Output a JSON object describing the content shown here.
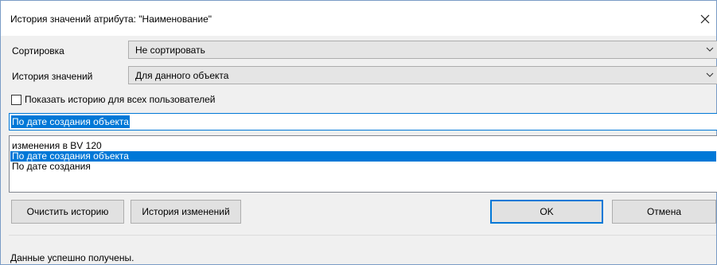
{
  "window": {
    "title": "История значений атрибута: \"Наименование\""
  },
  "sort": {
    "label": "Сортировка",
    "value": "Не сортировать"
  },
  "history": {
    "label": "История значений",
    "value": "Для данного объекта"
  },
  "show_all_users": {
    "label": "Показать историю для всех пользователей",
    "checked": false
  },
  "text_field": {
    "value": "По дате создания объекта"
  },
  "list": {
    "items": [
      {
        "label": "изменения в BV 120",
        "selected": false
      },
      {
        "label": "По дате создания объекта",
        "selected": true
      },
      {
        "label": "По дате создания",
        "selected": false
      }
    ]
  },
  "buttons": {
    "clear_history": "Очистить историю",
    "change_history": "История изменений",
    "ok": "OK",
    "cancel": "Отмена"
  },
  "status": {
    "text": "Данные успешно получены."
  },
  "colors": {
    "accent": "#0078d7",
    "window_bg": "#f0f0f0",
    "combo_bg": "#e5e5e5",
    "button_bg": "#e1e1e1"
  },
  "icons": {
    "close": "close-icon",
    "dropdown": "chevron-down-icon"
  }
}
